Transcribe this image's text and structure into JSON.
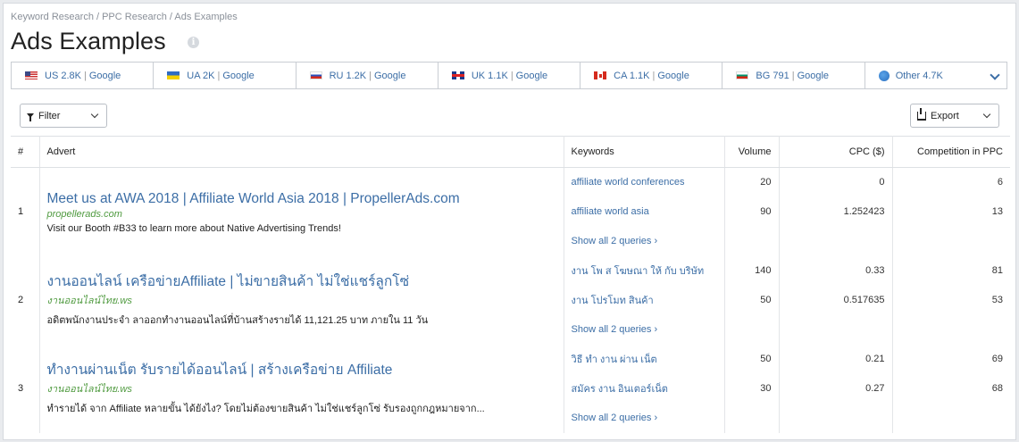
{
  "breadcrumb": "Keyword Research / PPC Research / Ads Examples",
  "page_title": "Ads Examples",
  "databases": [
    {
      "flag": "us",
      "label": "US 2.8K",
      "engine": "Google"
    },
    {
      "flag": "ua",
      "label": "UA 2K",
      "engine": "Google"
    },
    {
      "flag": "ru",
      "label": "RU 1.2K",
      "engine": "Google"
    },
    {
      "flag": "uk",
      "label": "UK 1.1K",
      "engine": "Google"
    },
    {
      "flag": "ca",
      "label": "CA 1.1K",
      "engine": "Google"
    },
    {
      "flag": "bg",
      "label": "BG 791",
      "engine": "Google"
    },
    {
      "flag": "globe",
      "label": "Other 4.7K",
      "engine": ""
    }
  ],
  "toolbar": {
    "filter_label": "Filter",
    "export_label": "Export"
  },
  "table": {
    "headers": {
      "num": "#",
      "advert": "Advert",
      "keywords": "Keywords",
      "volume": "Volume",
      "cpc": "CPC ($)",
      "competition": "Competition in PPC"
    },
    "rows": [
      {
        "num": "1",
        "title": "Meet us at AWA 2018 | Affiliate World Asia 2018 | PropellerAds.com",
        "url": "propellerads.com",
        "description": "Visit our Booth #B33 to learn more about Native Advertising Trends!",
        "keywords": [
          {
            "keyword": "affiliate world conferences",
            "volume": "20",
            "cpc": "0",
            "competition": "6"
          },
          {
            "keyword": "affiliate world asia",
            "volume": "90",
            "cpc": "1.252423",
            "competition": "13"
          }
        ],
        "show_all": "Show all 2 queries ›"
      },
      {
        "num": "2",
        "title": "งานออนไลน์ เครือข่ายAffiliate | ไม่ขายสินค้า ไม่ใช่แชร์ลูกโซ่",
        "url": "งานออนไลน์ไทย.ws",
        "description": "อดิตพนักงานประจำ ลาออกทำงานออนไลน์ที่บ้านสร้างรายได้ 11,121.25 บาท ภายใน 11 วัน",
        "keywords": [
          {
            "keyword": "งาน โพ ส โฆษณา ให้ กับ บริษัท",
            "volume": "140",
            "cpc": "0.33",
            "competition": "81"
          },
          {
            "keyword": "งาน โปรโมท สินค้า",
            "volume": "50",
            "cpc": "0.517635",
            "competition": "53"
          }
        ],
        "show_all": "Show all 2 queries ›"
      },
      {
        "num": "3",
        "title": "ทำงานผ่านเน็ต รับรายได้ออนไลน์ | สร้างเครือข่าย Affiliate",
        "url": "งานออนไลน์ไทย.ws",
        "description": "ทำรายได้ จาก Affiliate หลายขั้น ได้ยังไง? โดยไม่ต้องขายสินค้า ไม่ใช่แชร์ลูกโซ่ รับรองถูกกฎหมายจาก...",
        "keywords": [
          {
            "keyword": "วิธี ทำ งาน ผ่าน เน็ต",
            "volume": "50",
            "cpc": "0.21",
            "competition": "69"
          },
          {
            "keyword": "สมัคร งาน อินเตอร์เน็ต",
            "volume": "30",
            "cpc": "0.27",
            "competition": "68"
          }
        ],
        "show_all": "Show all 2 queries ›"
      }
    ]
  }
}
